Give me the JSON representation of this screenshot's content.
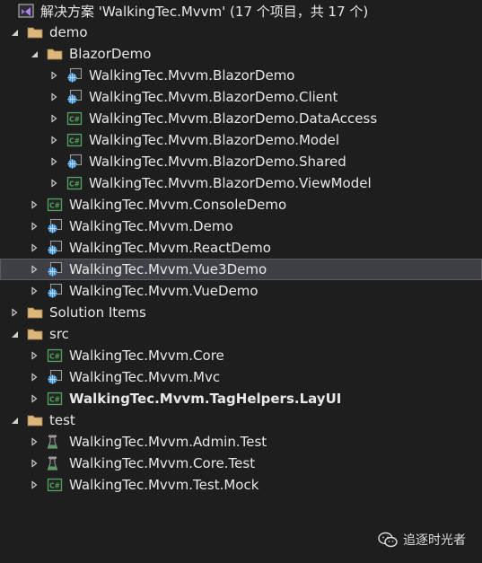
{
  "solution": {
    "title": "解决方案 'WalkingTec.Mvvm' (17 个项目，共 17 个)",
    "icon": "vs-solution-icon"
  },
  "colors": {
    "background": "#1e1e1e",
    "text": "#e8e8e8",
    "folder": "#dcb67a",
    "csharp": "#4fa35c",
    "web": "#3b8fd6",
    "test": "#4fa35c",
    "selection": "#3f3f46"
  },
  "tree": [
    {
      "label": "demo",
      "level": 0,
      "kind": "folder",
      "expanded": true
    },
    {
      "label": "BlazorDemo",
      "level": 1,
      "kind": "folder",
      "expanded": true
    },
    {
      "label": "WalkingTec.Mvvm.BlazorDemo",
      "level": 2,
      "kind": "web",
      "expanded": false
    },
    {
      "label": "WalkingTec.Mvvm.BlazorDemo.Client",
      "level": 2,
      "kind": "web",
      "expanded": false
    },
    {
      "label": "WalkingTec.Mvvm.BlazorDemo.DataAccess",
      "level": 2,
      "kind": "csharp",
      "expanded": false
    },
    {
      "label": "WalkingTec.Mvvm.BlazorDemo.Model",
      "level": 2,
      "kind": "csharp",
      "expanded": false
    },
    {
      "label": "WalkingTec.Mvvm.BlazorDemo.Shared",
      "level": 2,
      "kind": "web",
      "expanded": false
    },
    {
      "label": "WalkingTec.Mvvm.BlazorDemo.ViewModel",
      "level": 2,
      "kind": "csharp",
      "expanded": false
    },
    {
      "label": "WalkingTec.Mvvm.ConsoleDemo",
      "level": 1,
      "kind": "csharp",
      "expanded": false
    },
    {
      "label": "WalkingTec.Mvvm.Demo",
      "level": 1,
      "kind": "web",
      "expanded": false
    },
    {
      "label": "WalkingTec.Mvvm.ReactDemo",
      "level": 1,
      "kind": "web",
      "expanded": false
    },
    {
      "label": "WalkingTec.Mvvm.Vue3Demo",
      "level": 1,
      "kind": "web",
      "expanded": false,
      "selected": true
    },
    {
      "label": "WalkingTec.Mvvm.VueDemo",
      "level": 1,
      "kind": "web",
      "expanded": false
    },
    {
      "label": "Solution Items",
      "level": 0,
      "kind": "folder",
      "expanded": false
    },
    {
      "label": "src",
      "level": 0,
      "kind": "folder",
      "expanded": true
    },
    {
      "label": "WalkingTec.Mvvm.Core",
      "level": 1,
      "kind": "csharp",
      "expanded": false
    },
    {
      "label": "WalkingTec.Mvvm.Mvc",
      "level": 1,
      "kind": "web",
      "expanded": false
    },
    {
      "label": "WalkingTec.Mvvm.TagHelpers.LayUI",
      "level": 1,
      "kind": "csharp",
      "expanded": false,
      "bold": true
    },
    {
      "label": "test",
      "level": 0,
      "kind": "folder",
      "expanded": true
    },
    {
      "label": "WalkingTec.Mvvm.Admin.Test",
      "level": 1,
      "kind": "test",
      "expanded": false
    },
    {
      "label": "WalkingTec.Mvvm.Core.Test",
      "level": 1,
      "kind": "test",
      "expanded": false
    },
    {
      "label": "WalkingTec.Mvvm.Test.Mock",
      "level": 1,
      "kind": "csharp",
      "expanded": false
    }
  ],
  "watermark": {
    "text": "追逐时光者",
    "icon": "wechat-icon"
  }
}
